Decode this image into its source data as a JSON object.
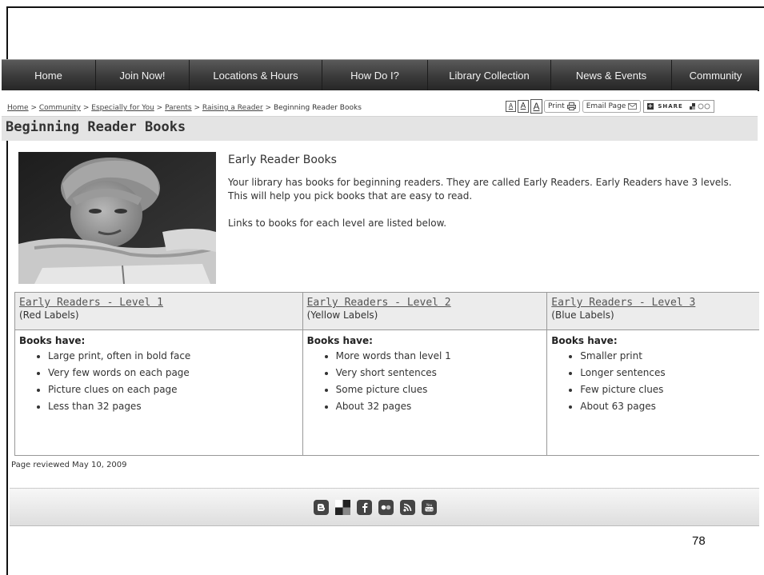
{
  "nav": {
    "items": [
      {
        "label": "Home"
      },
      {
        "label": "Join Now!"
      },
      {
        "label": "Locations & Hours"
      },
      {
        "label": "How Do I?"
      },
      {
        "label": "Library Collection"
      },
      {
        "label": "News & Events"
      },
      {
        "label": "Community"
      }
    ]
  },
  "breadcrumb": {
    "links": [
      "Home",
      "Community",
      "Especially for You",
      "Parents",
      "Raising a Reader"
    ],
    "separator": ">",
    "current": "Beginning Reader Books"
  },
  "tools": {
    "font_sizes": [
      "A",
      "A",
      "A"
    ],
    "print_label": "Print",
    "email_label": "Email Page",
    "share_label": "SHARE"
  },
  "page": {
    "title": "Beginning Reader Books",
    "photo_icon": "child-reading-photo"
  },
  "intro": {
    "heading": "Early Reader Books",
    "paragraph1": "Your library has books for beginning readers.  They are called Early Readers.  Early Readers have 3 levels.  This will help you pick books that are easy to read.",
    "paragraph2": "Links to books for each level are listed below."
  },
  "levels": [
    {
      "link": "Early Readers - Level 1",
      "labels": "(Red Labels)",
      "heading": "Books have:",
      "features": [
        "Large print, often in bold face",
        "Very few words on each page",
        "Picture clues on each page",
        "Less than 32 pages"
      ]
    },
    {
      "link": "Early Readers - Level 2",
      "labels": "(Yellow Labels)",
      "heading": "Books have:",
      "features": [
        "More words than level 1",
        "Very short sentences",
        "Some picture clues",
        "About 32 pages"
      ]
    },
    {
      "link": "Early Readers - Level 3",
      "labels": "(Blue Labels)",
      "heading": "Books have:",
      "features": [
        "Smaller print",
        "Longer sentences",
        "Few picture clues",
        "About 63 pages"
      ]
    }
  ],
  "reviewed": "Page reviewed May 10, 2009",
  "footer": {
    "social_icons": [
      "blogger-icon",
      "delicious-icon",
      "facebook-icon",
      "flickr-icon",
      "rss-icon",
      "youtube-icon"
    ]
  },
  "slide_number": "78"
}
